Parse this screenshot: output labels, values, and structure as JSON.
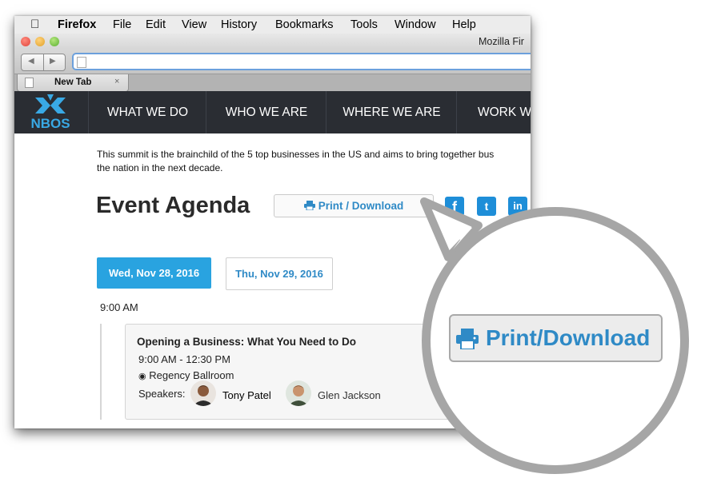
{
  "menubar": {
    "app": "Firefox",
    "items": [
      "File",
      "Edit",
      "View",
      "History",
      "Bookmarks",
      "Tools",
      "Window",
      "Help"
    ]
  },
  "window": {
    "title": "Mozilla Fir"
  },
  "browser": {
    "url": "",
    "tab_label": "New Tab",
    "tab_close": "×"
  },
  "site": {
    "logo_text": "NBOS",
    "nav": [
      "WHAT WE DO",
      "WHO WE ARE",
      "WHERE WE ARE",
      "WORK W"
    ]
  },
  "intro": {
    "line1": "This summit is the brainchild of the 5 top businesses in the US and aims to bring together bus",
    "line2": "the nation in the next decade."
  },
  "page": {
    "title": "Event Agenda",
    "print_label": "Print / Download"
  },
  "social": [
    "f",
    "t",
    "in"
  ],
  "days": {
    "active": "Wed, Nov 28, 2016",
    "inactive": "Thu, Nov 29, 2016"
  },
  "agenda": {
    "time": "9:00 AM",
    "session": {
      "title": "Opening a Business: What You Need to Do",
      "time": "9:00 AM - 12:30 PM",
      "location": "Regency Ballroom",
      "speakers_label": "Speakers:",
      "speakers": [
        "Tony Patel",
        "Glen Jackson"
      ]
    }
  },
  "callout": {
    "label": "Print/Download"
  },
  "colors": {
    "accent": "#2f8ac6",
    "nav_bg": "#2a2d33",
    "active_day_bg": "#29a3e0",
    "social": "#1e8ed8",
    "callout_ring": "#a6a6a6"
  }
}
